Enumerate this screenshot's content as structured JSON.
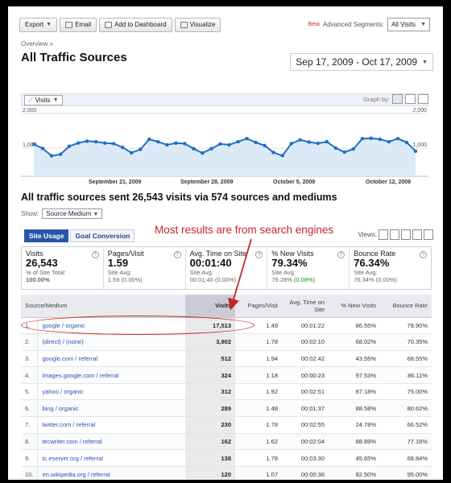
{
  "toolbar": {
    "export_label": "Export",
    "email_label": "Email",
    "dashboard_label": "Add to Dashboard",
    "visualize_label": "Visualize"
  },
  "segments": {
    "beta": "Beta",
    "label": "Advanced Segments:",
    "selected": "All Visits"
  },
  "breadcrumb": "Overview »",
  "page_title": "All Traffic Sources",
  "date_range": "Sep 17, 2009 - Oct 17, 2009",
  "graph": {
    "metric": "Visits",
    "graph_by_label": "Graph by:",
    "y_max_label": "2,000",
    "y_mid_label": "1,000",
    "date_labels": [
      "September 21, 2009",
      "September 28, 2009",
      "October 5, 2009",
      "October 12, 2009"
    ]
  },
  "chart_data": {
    "type": "line",
    "title": "",
    "xlabel": "",
    "ylabel": "",
    "ylim": [
      0,
      2000
    ],
    "series": [
      {
        "name": "Visits",
        "values": [
          1020,
          890,
          650,
          700,
          960,
          1060,
          1120,
          1100,
          1060,
          1040,
          920,
          750,
          860,
          1180,
          1100,
          1000,
          1060,
          1040,
          880,
          740,
          880,
          1030,
          1000,
          1100,
          1200,
          1080,
          980,
          760,
          660,
          1040,
          1160,
          1090,
          1050,
          1100,
          900,
          770,
          870,
          1200,
          1210,
          1180,
          1100,
          1200,
          1080,
          800
        ]
      }
    ]
  },
  "summary_heading": "All traffic sources sent 26,543 visits via 574 sources and mediums",
  "show": {
    "label": "Show:",
    "selected": "Source Medium"
  },
  "tabs": [
    "Site Usage",
    "Goal Conversion"
  ],
  "views_label": "Views:",
  "annotation": "Most results are from search engines",
  "scorecards": [
    {
      "title": "Visits",
      "value": "26,543",
      "sub1": "% of Site Total:",
      "sub2": "100.00%"
    },
    {
      "title": "Pages/Visit",
      "value": "1.59",
      "sub1": "Site Avg:",
      "sub2": "1.59 (0.00%)"
    },
    {
      "title": "Avg. Time on Site",
      "value": "00:01:40",
      "sub1": "Site Avg:",
      "sub2": "00:01:40 (0.00%)"
    },
    {
      "title": "% New Visits",
      "value": "79.34%",
      "sub1": "Site Avg:",
      "sub2": "79.28%",
      "sub2_change": "(0.08%)"
    },
    {
      "title": "Bounce Rate",
      "value": "76.34%",
      "sub1": "Site Avg:",
      "sub2": "76.34% (0.00%)"
    }
  ],
  "table": {
    "headers": [
      "Source/Medium",
      "Visits",
      "Pages/Visit",
      "Avg. Time on Site",
      "% New Visits",
      "Bounce Rate"
    ],
    "rows": [
      {
        "n": "1.",
        "source": "google / organic",
        "visits": "17,513",
        "ppv": "1.49",
        "time": "00:01:22",
        "new": "86.55%",
        "bounce": "78.90%"
      },
      {
        "n": "2.",
        "source": "(direct) / (none)",
        "visits": "3,902",
        "ppv": "1.78",
        "time": "00:02:10",
        "new": "68.02%",
        "bounce": "70.35%"
      },
      {
        "n": "3.",
        "source": "google.com / referral",
        "visits": "512",
        "ppv": "1.94",
        "time": "00:02:42",
        "new": "43.55%",
        "bounce": "68.55%"
      },
      {
        "n": "4.",
        "source": "images.google.com / referral",
        "visits": "324",
        "ppv": "1.18",
        "time": "00:00:23",
        "new": "97.53%",
        "bounce": "86.11%"
      },
      {
        "n": "5.",
        "source": "yahoo / organic",
        "visits": "312",
        "ppv": "1.92",
        "time": "00:02:51",
        "new": "87.18%",
        "bounce": "75.00%"
      },
      {
        "n": "6.",
        "source": "bing / organic",
        "visits": "289",
        "ppv": "1.48",
        "time": "00:01:37",
        "new": "88.58%",
        "bounce": "80.62%"
      },
      {
        "n": "7.",
        "source": "twitter.com / referral",
        "visits": "230",
        "ppv": "1.78",
        "time": "00:02:55",
        "new": "24.78%",
        "bounce": "66.52%"
      },
      {
        "n": "8.",
        "source": "tecwriter.com / referral",
        "visits": "162",
        "ppv": "1.62",
        "time": "00:02:04",
        "new": "88.89%",
        "bounce": "77.16%"
      },
      {
        "n": "9.",
        "source": "tc.eserver.org / referral",
        "visits": "138",
        "ppv": "1.78",
        "time": "00:03:30",
        "new": "45.65%",
        "bounce": "68.84%"
      },
      {
        "n": "10.",
        "source": "en.wikipedia.org / referral",
        "visits": "120",
        "ppv": "1.07",
        "time": "00:00:36",
        "new": "82.50%",
        "bounce": "95.00%"
      }
    ]
  },
  "colors": {
    "accent": "#2a56a8",
    "line": "#1f6fc4",
    "annotation": "#c2272d"
  }
}
